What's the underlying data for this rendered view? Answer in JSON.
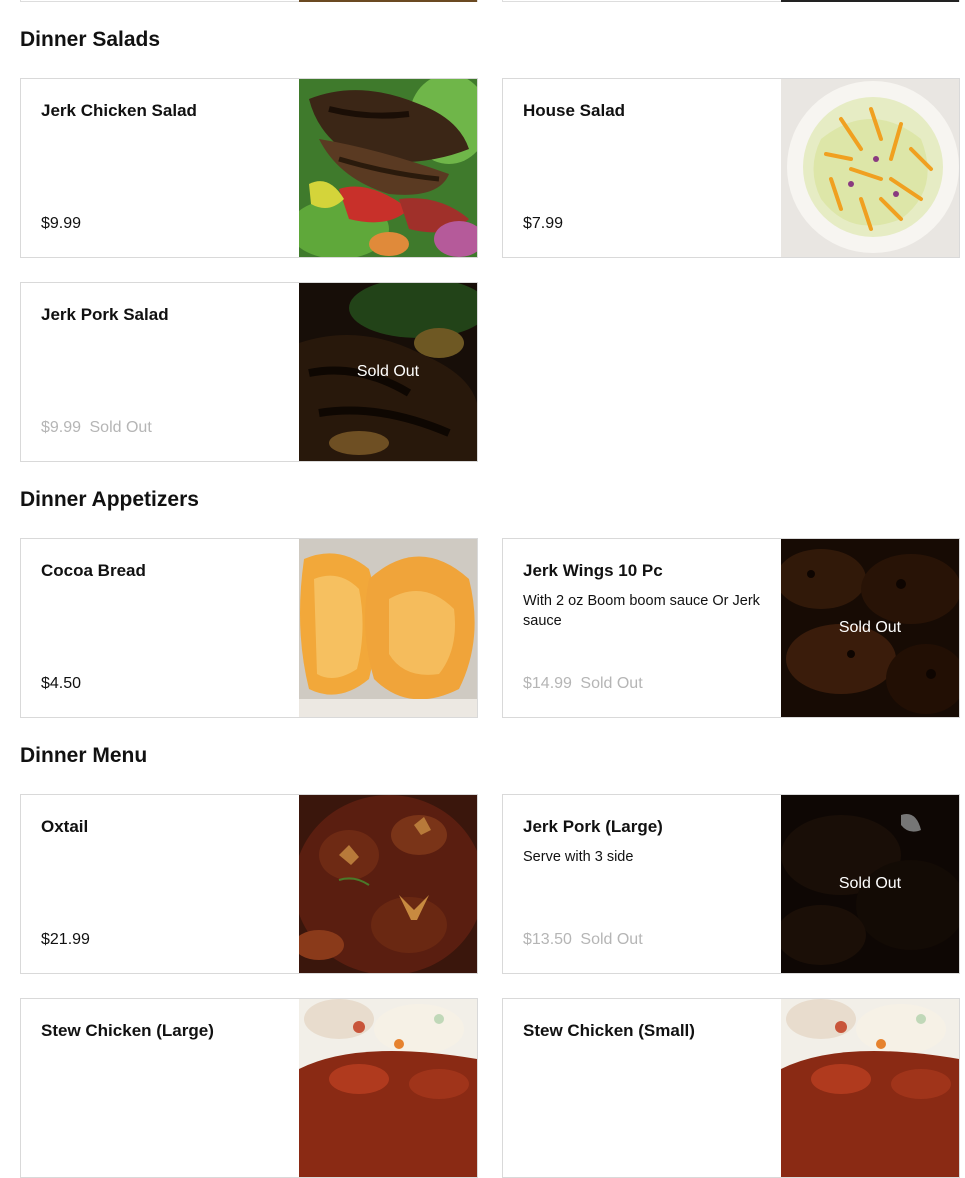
{
  "sections": [
    {
      "title": "Dinner Salads",
      "items": [
        {
          "name": "Jerk Chicken Salad",
          "description": "",
          "price": "$9.99",
          "sold_out_label": ""
        },
        {
          "name": "House Salad",
          "description": "",
          "price": "$7.99",
          "sold_out_label": ""
        },
        {
          "name": "Jerk Pork Salad",
          "description": "",
          "price": "$9.99",
          "sold_out_label": "Sold Out",
          "overlay_label": "Sold Out"
        }
      ]
    },
    {
      "title": "Dinner Appetizers",
      "items": [
        {
          "name": "Cocoa Bread",
          "description": "",
          "price": "$4.50",
          "sold_out_label": ""
        },
        {
          "name": "Jerk Wings 10 Pc",
          "description": "With 2 oz Boom boom sauce Or Jerk sauce",
          "price": "$14.99",
          "sold_out_label": "Sold Out",
          "overlay_label": "Sold Out"
        }
      ]
    },
    {
      "title": "Dinner Menu",
      "items": [
        {
          "name": "Oxtail",
          "description": "",
          "price": "$21.99",
          "sold_out_label": ""
        },
        {
          "name": "Jerk Pork (Large)",
          "description": "Serve with 3 side",
          "price": "$13.50",
          "sold_out_label": "Sold Out",
          "overlay_label": "Sold Out"
        },
        {
          "name": "Stew Chicken (Large)",
          "description": "",
          "price": "",
          "sold_out_label": ""
        },
        {
          "name": "Stew Chicken (Small)",
          "description": "",
          "price": "",
          "sold_out_label": ""
        }
      ]
    }
  ],
  "icons": {
    "jerk_chicken_salad": "grilled-chicken-salad-photo",
    "house_salad": "house-salad-photo",
    "jerk_pork_salad": "jerk-pork-salad-photo",
    "cocoa_bread": "cocoa-bread-photo",
    "jerk_wings": "jerk-wings-photo",
    "oxtail": "oxtail-photo",
    "jerk_pork": "jerk-pork-photo",
    "stew_chicken": "stew-chicken-photo"
  },
  "colors": {
    "sold_out_price": "#b5b5b5",
    "card_border": "#d9d9d9",
    "text": "#111111"
  }
}
